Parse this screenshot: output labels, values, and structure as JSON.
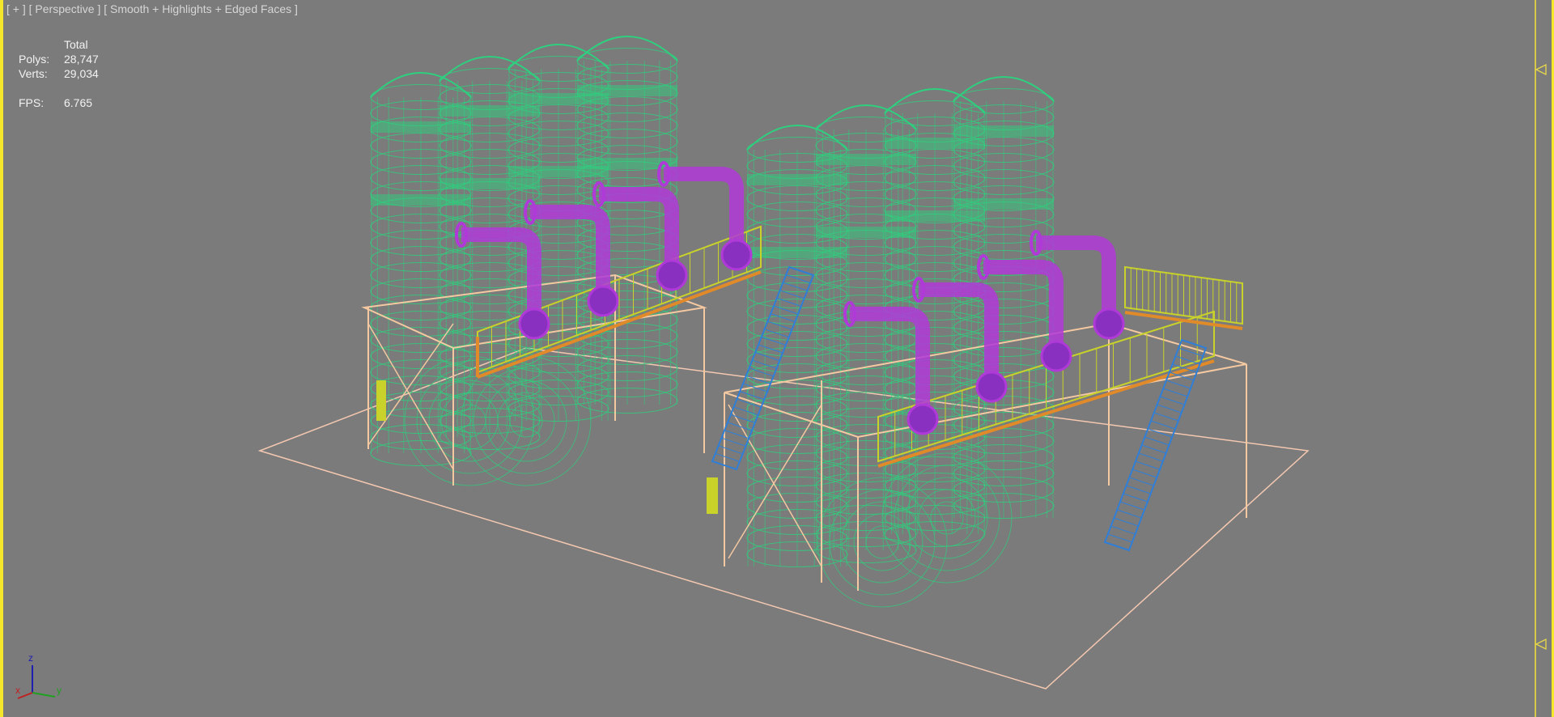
{
  "viewport": {
    "label_menu": "[ + ]",
    "label_view": "[ Perspective ]",
    "label_shading": "[ Smooth + Highlights + Edged Faces ]",
    "active_border_color": "#f5e82a",
    "background_color": "#7b7b7b"
  },
  "stats": {
    "header": "Total",
    "polys_label": "Polys:",
    "polys_value": "28,747",
    "verts_label": "Verts:",
    "verts_value": "29,034",
    "fps_label": "FPS:",
    "fps_value": "6.765"
  },
  "axis_gizmo": {
    "x": "x",
    "y": "y",
    "z": "z"
  },
  "scene_colors": {
    "tanks": "#2ecf7e",
    "pipes": "#b03ad8",
    "structure": "#f4c8a0",
    "railing": "#c8d22a",
    "deck": "#e08a2a",
    "stairs": "#2f7fd8",
    "ground": "#f4c8b0"
  }
}
